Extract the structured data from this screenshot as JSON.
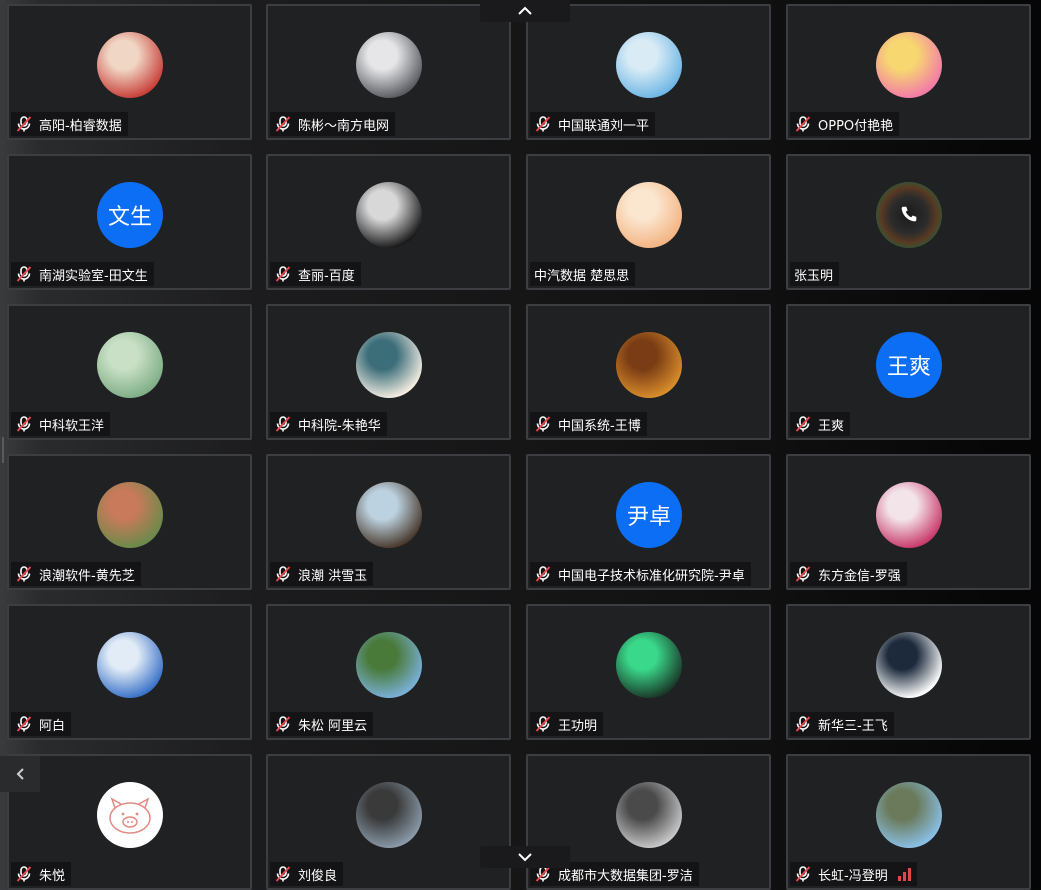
{
  "participants": [
    {
      "name": "高阳-柏睿数据",
      "muted": true,
      "avatar": "photo",
      "colors": [
        "#c8403a",
        "#f0d6c4"
      ]
    },
    {
      "name": "陈彬～南方电网",
      "muted": true,
      "avatar": "photo",
      "colors": [
        "#5a5c62",
        "#e6e6e8"
      ]
    },
    {
      "name": "中国联通刘一平",
      "muted": true,
      "avatar": "photo",
      "colors": [
        "#6fb6e4",
        "#d9ecf6"
      ]
    },
    {
      "name": "OPPO付艳艳",
      "muted": true,
      "avatar": "photo",
      "colors": [
        "#f27aa8",
        "#f7d870"
      ]
    },
    {
      "name": "南湖实验室-田文生",
      "muted": true,
      "avatar": "initials",
      "initials": "文生",
      "colors": [
        "#0b6ef5",
        "#0b6ef5"
      ]
    },
    {
      "name": "查丽-百度",
      "muted": true,
      "avatar": "photo",
      "colors": [
        "#1a1a1a",
        "#d8d8d8"
      ]
    },
    {
      "name": "中汽数据 楚思思",
      "muted": false,
      "avatar": "photo",
      "colors": [
        "#f3b483",
        "#fbe6cf"
      ]
    },
    {
      "name": "张玉明",
      "muted": false,
      "avatar": "phone",
      "colors": [
        "#2a2a2a",
        "#6a3a2a"
      ]
    },
    {
      "name": "中科软王洋",
      "muted": true,
      "avatar": "photo",
      "colors": [
        "#7fae86",
        "#c9e0c6"
      ]
    },
    {
      "name": "中科院-朱艳华",
      "muted": true,
      "avatar": "photo",
      "colors": [
        "#f4ede2",
        "#3c6e7a"
      ]
    },
    {
      "name": "中国系统-王博",
      "muted": true,
      "avatar": "photo",
      "colors": [
        "#d98d2b",
        "#7a3c14"
      ]
    },
    {
      "name": "王爽",
      "muted": true,
      "avatar": "initials",
      "initials": "王爽",
      "colors": [
        "#0b6ef5",
        "#0b6ef5"
      ]
    },
    {
      "name": "浪潮软件-黄先芝",
      "muted": true,
      "avatar": "photo",
      "colors": [
        "#6a8a4a",
        "#c87a5a"
      ]
    },
    {
      "name": "浪潮 洪雪玉",
      "muted": true,
      "avatar": "photo",
      "colors": [
        "#4a3a2e",
        "#bcd2e0"
      ]
    },
    {
      "name": "中国电子技术标准化研究院-尹卓",
      "muted": true,
      "avatar": "initials",
      "initials": "尹卓",
      "colors": [
        "#0b6ef5",
        "#0b6ef5"
      ]
    },
    {
      "name": "东方金信-罗强",
      "muted": true,
      "avatar": "photo",
      "colors": [
        "#c83a6a",
        "#f3e4ea"
      ]
    },
    {
      "name": "阿白",
      "muted": true,
      "avatar": "photo",
      "colors": [
        "#3a72c8",
        "#e2ecf6"
      ]
    },
    {
      "name": "朱松 阿里云",
      "muted": true,
      "avatar": "photo",
      "colors": [
        "#7ab0d8",
        "#4a7a3a"
      ]
    },
    {
      "name": "王功明",
      "muted": true,
      "avatar": "photo",
      "colors": [
        "#1a3a2a",
        "#3ad88a"
      ]
    },
    {
      "name": "新华三-王飞",
      "muted": true,
      "avatar": "photo",
      "colors": [
        "#ffffff",
        "#1c2a3c"
      ]
    },
    {
      "name": "朱悦",
      "muted": true,
      "avatar": "pig",
      "colors": [
        "#ffffff",
        "#e28a84"
      ]
    },
    {
      "name": "刘俊良",
      "muted": true,
      "avatar": "photo",
      "colors": [
        "#8a9aa8",
        "#3a3a3a"
      ]
    },
    {
      "name": "成都市大数据集团-罗洁",
      "muted": true,
      "avatar": "photo",
      "colors": [
        "#c8c8c8",
        "#4a4a4a"
      ]
    },
    {
      "name": "长虹-冯登明",
      "muted": true,
      "avatar": "photo",
      "colors": [
        "#8ac0e6",
        "#6a7a5a"
      ],
      "signal": true
    }
  ],
  "accent_colors": {
    "initials_bg": "#0b6ef5",
    "signal": "#e04848",
    "tile_border": "#3d3e41",
    "tile_bg": "#202123"
  },
  "icons": {
    "scroll_up": "chevron-up-icon",
    "scroll_down": "chevron-down-icon",
    "prev_page": "chevron-left-icon",
    "mic_muted": "mic-muted-icon"
  }
}
